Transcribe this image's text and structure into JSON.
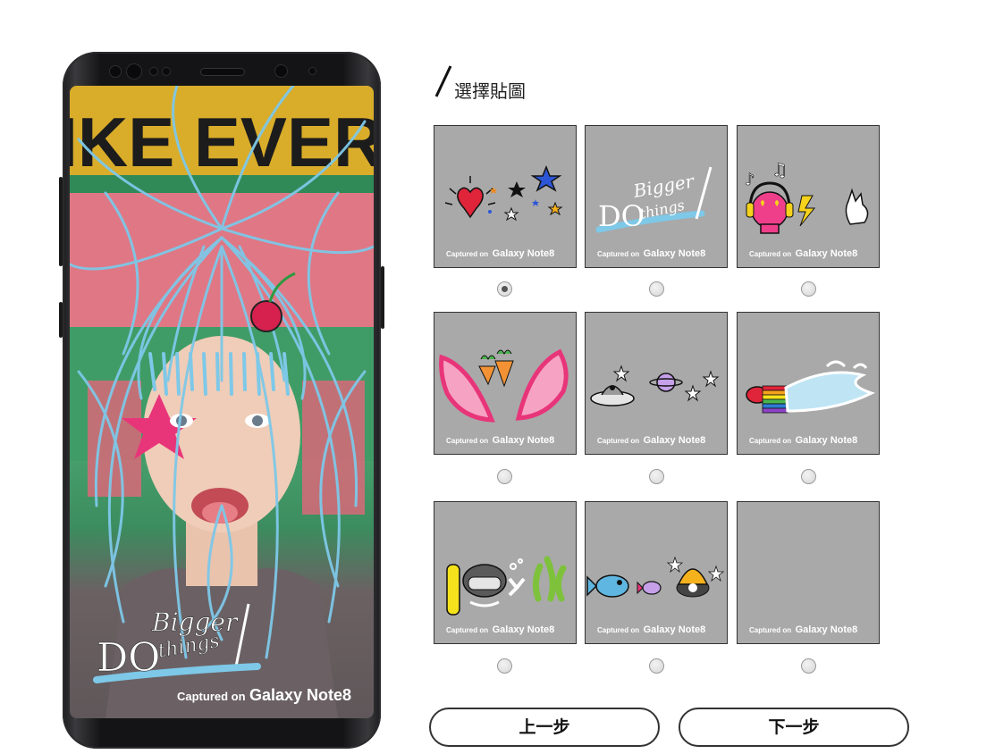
{
  "page": {
    "section_title": "選擇貼圖",
    "selected_index": 0
  },
  "phone_preview": {
    "background_sign_text": "LIKE EVERY",
    "sticker_text_top": "Bigger",
    "sticker_text_left": "DO",
    "sticker_text_bottom": "things",
    "caption_prefix": "Captured on",
    "caption_brand": "Galaxy Note8"
  },
  "stickers": [
    {
      "name": "hearts-stars",
      "caption_prefix": "Captured on",
      "caption_brand": "Galaxy Note8"
    },
    {
      "name": "do-bigger-things",
      "caption_prefix": "Captured on",
      "caption_brand": "Galaxy Note8",
      "text_top": "Bigger",
      "text_left": "DO",
      "text_bottom": "things"
    },
    {
      "name": "music-skull",
      "caption_prefix": "Captured on",
      "caption_brand": "Galaxy Note8"
    },
    {
      "name": "bunny-ears-carrots",
      "caption_prefix": "Captured on",
      "caption_brand": "Galaxy Note8"
    },
    {
      "name": "space-ufo",
      "caption_prefix": "Captured on",
      "caption_brand": "Galaxy Note8"
    },
    {
      "name": "rainbow-tongue",
      "caption_prefix": "Captured on",
      "caption_brand": "Galaxy Note8"
    },
    {
      "name": "diver-seaweed",
      "caption_prefix": "Captured on",
      "caption_brand": "Galaxy Note8"
    },
    {
      "name": "fish-shell",
      "caption_prefix": "Captured on",
      "caption_brand": "Galaxy Note8"
    },
    {
      "name": "blank",
      "caption_prefix": "Captured on",
      "caption_brand": "Galaxy Note8"
    }
  ],
  "buttons": {
    "prev_label": "上一步",
    "next_label": "下一步"
  },
  "colors": {
    "thumb_bg": "#a9a9a9",
    "hair_blue": "#7ec8e8",
    "accent_pink": "#e8357a"
  }
}
